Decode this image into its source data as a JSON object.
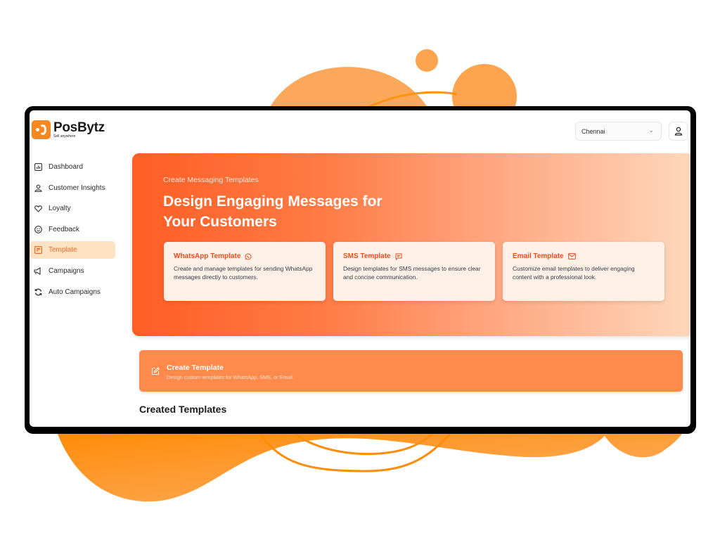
{
  "brand": {
    "name": "PosBytz",
    "tagline": "Sell anywhere",
    "accent": "#f7871f"
  },
  "header": {
    "branch_select": {
      "value": "Chennai"
    },
    "user_button": {
      "icon": "user-icon"
    }
  },
  "sidebar": {
    "items": [
      {
        "label": "Dashboard",
        "icon": "chart-icon",
        "active": false
      },
      {
        "label": "Customer Insights",
        "icon": "user-icon",
        "active": false
      },
      {
        "label": "Loyalty",
        "icon": "heart-icon",
        "active": false
      },
      {
        "label": "Feedback",
        "icon": "smiley-icon",
        "active": false
      },
      {
        "label": "Template",
        "icon": "template-icon",
        "active": true
      },
      {
        "label": "Campaigns",
        "icon": "megaphone-icon",
        "active": false
      },
      {
        "label": "Auto Campaigns",
        "icon": "refresh-icon",
        "active": false
      }
    ]
  },
  "hero": {
    "eyebrow": "Create Messaging Templates",
    "title": "Design Engaging Messages for Your Customers",
    "cards": [
      {
        "title": "WhatsApp Template",
        "icon": "whatsapp-icon",
        "description": "Create and manage templates for sending WhatsApp messages directly to customers."
      },
      {
        "title": "SMS Template",
        "icon": "message-icon",
        "description": "Design templates for SMS messages to ensure clear and concise communication."
      },
      {
        "title": "Email Template",
        "icon": "mail-icon",
        "description": "Customize email templates to deliver engaging content with a professional look."
      }
    ]
  },
  "create_template": {
    "title": "Create Template",
    "subtitle": "Design custom templates for WhatsApp, SMS, or Email.",
    "icon": "edit-icon"
  },
  "created_templates": {
    "title": "Created Templates"
  }
}
